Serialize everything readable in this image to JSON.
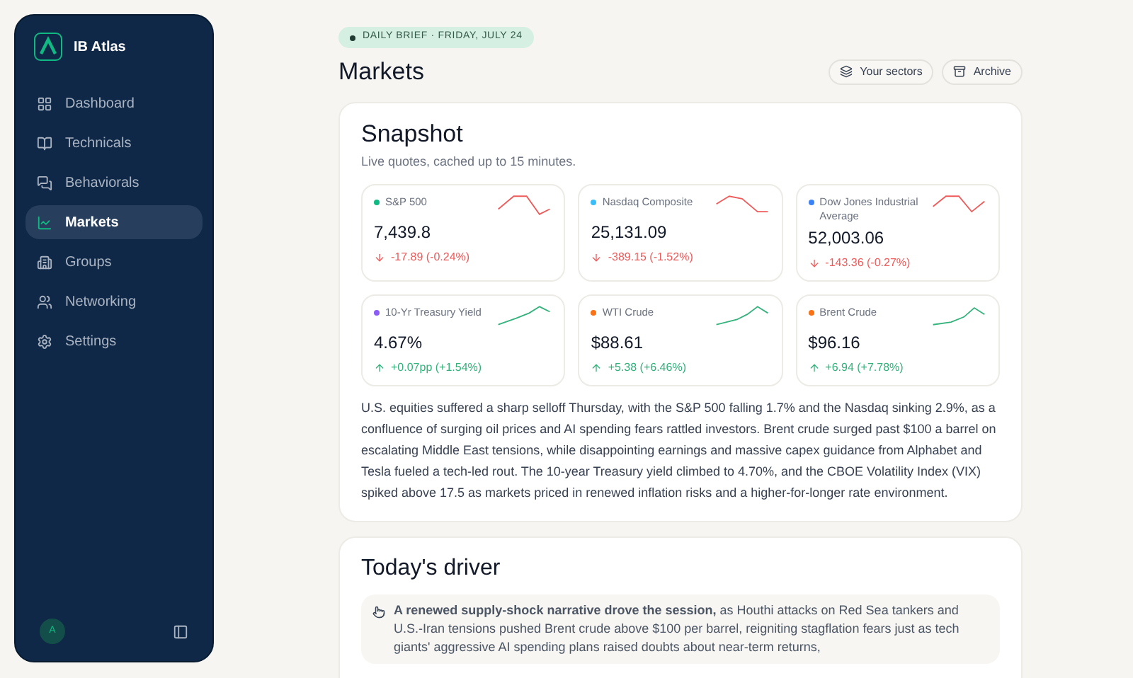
{
  "sidebar": {
    "brand": "IB Atlas",
    "items": [
      {
        "label": "Dashboard",
        "selected": false
      },
      {
        "label": "Technicals",
        "selected": false
      },
      {
        "label": "Behaviorals",
        "selected": false
      },
      {
        "label": "Markets",
        "selected": true
      },
      {
        "label": "Groups",
        "selected": false
      },
      {
        "label": "Networking",
        "selected": false
      },
      {
        "label": "Settings",
        "selected": false
      }
    ],
    "avatar": "A"
  },
  "header": {
    "badge": "DAILY BRIEF · FRIDAY, JULY 24",
    "title": "Markets",
    "buttons": [
      {
        "label": "Your sectors"
      },
      {
        "label": "Archive"
      }
    ]
  },
  "snapshot": {
    "title": "Snapshot",
    "subtitle": "Live quotes, cached up to 15 minutes.",
    "quotes": [
      {
        "name": "S&P 500",
        "color": "#10b981",
        "value": "7,439.8",
        "change": "-17.89 (-0.24%)",
        "kind": "down"
      },
      {
        "name": "Nasdaq Composite",
        "color": "#38bdf8",
        "value": "25,131.09",
        "change": "-389.15 (-1.52%)",
        "kind": "down"
      },
      {
        "name": "Dow Jones Industrial Average",
        "color": "#3b82f6",
        "value": "52,003.06",
        "change": "-143.36 (-0.27%)",
        "kind": "down"
      },
      {
        "name": "10-Yr Treasury Yield",
        "color": "#8b5cf6",
        "value": "4.67%",
        "change": "+0.07pp (+1.54%)",
        "kind": "up"
      },
      {
        "name": "WTI Crude",
        "color": "#f97316",
        "value": "$88.61",
        "change": "+5.38 (+6.46%)",
        "kind": "up"
      },
      {
        "name": "Brent Crude",
        "color": "#f97316",
        "value": "$96.16",
        "change": "+6.94 (+7.78%)",
        "kind": "up"
      }
    ],
    "summary": "U.S. equities suffered a sharp selloff Thursday, with the S&P 500 falling 1.7% and the Nasdaq sinking 2.9%, as a confluence of surging oil prices and AI spending fears rattled investors. Brent crude surged past $100 a barrel on escalating Middle East tensions, while disappointing earnings and massive capex guidance from Alphabet and Tesla fueled a tech-led rout. The 10-year Treasury yield climbed to 4.70%, and the CBOE Volatility Index (VIX) spiked above 17.5 as markets priced in renewed inflation risks and a higher-for-longer rate environment."
  },
  "driver": {
    "title": "Today's driver",
    "text": "**A renewed supply-shock narrative drove the session,** as Houthi attacks on Red Sea tankers and U.S.-Iran tensions pushed Brent crude above $100 per barrel, reigniting stagflation fears just as tech giants' aggressive AI spending plans raised doubts about near-term returns,"
  }
}
